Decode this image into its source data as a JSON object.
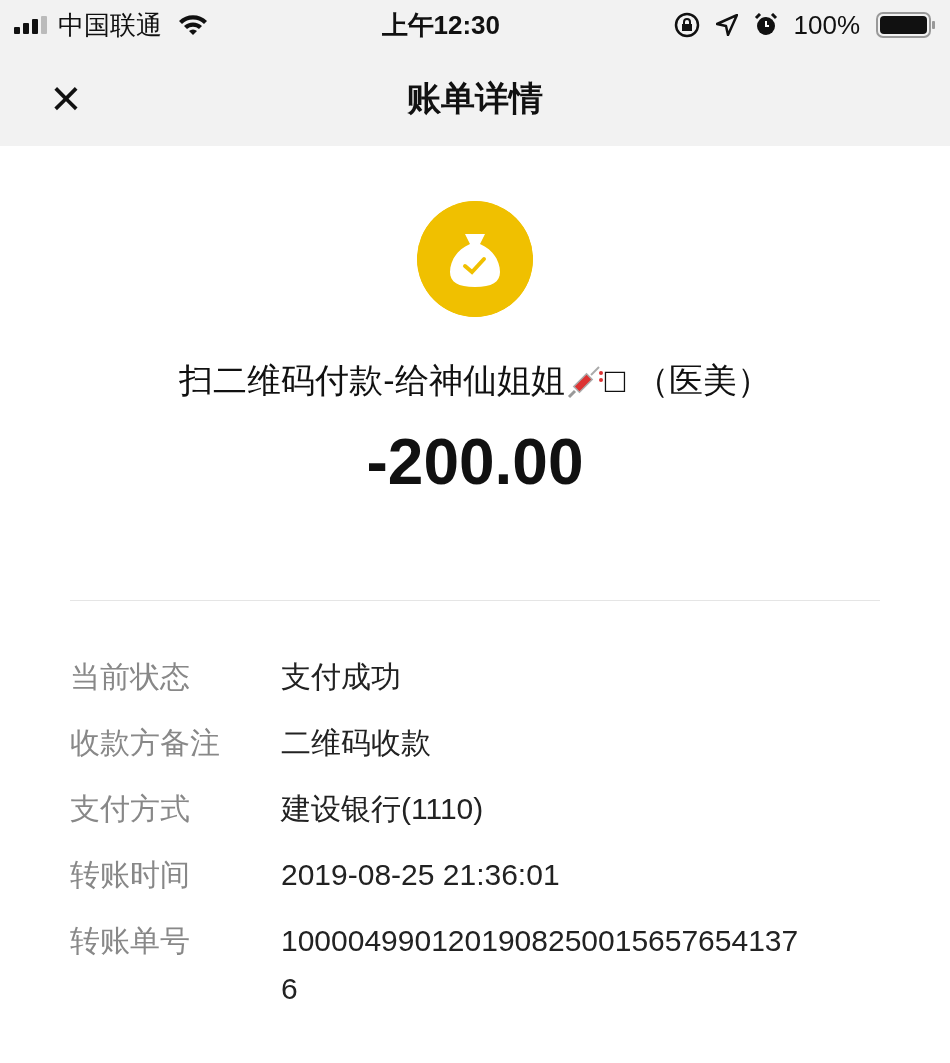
{
  "status_bar": {
    "carrier": "中国联通",
    "time": "上午12:30",
    "battery": "100%"
  },
  "header": {
    "close": "×",
    "title": "账单详情"
  },
  "bill": {
    "title_before": "扫二维码付款-给神仙姐姐",
    "title_after": "□ （医美）",
    "amount": "-200.00"
  },
  "details": [
    {
      "label": "当前状态",
      "value": "支付成功"
    },
    {
      "label": "收款方备注",
      "value": "二维码收款"
    },
    {
      "label": "支付方式",
      "value": "建设银行(1110)"
    },
    {
      "label": "转账时间",
      "value": "2019-08-25 21:36:01"
    },
    {
      "label": "转账单号",
      "value": "10000499012019082500156576541376"
    }
  ]
}
